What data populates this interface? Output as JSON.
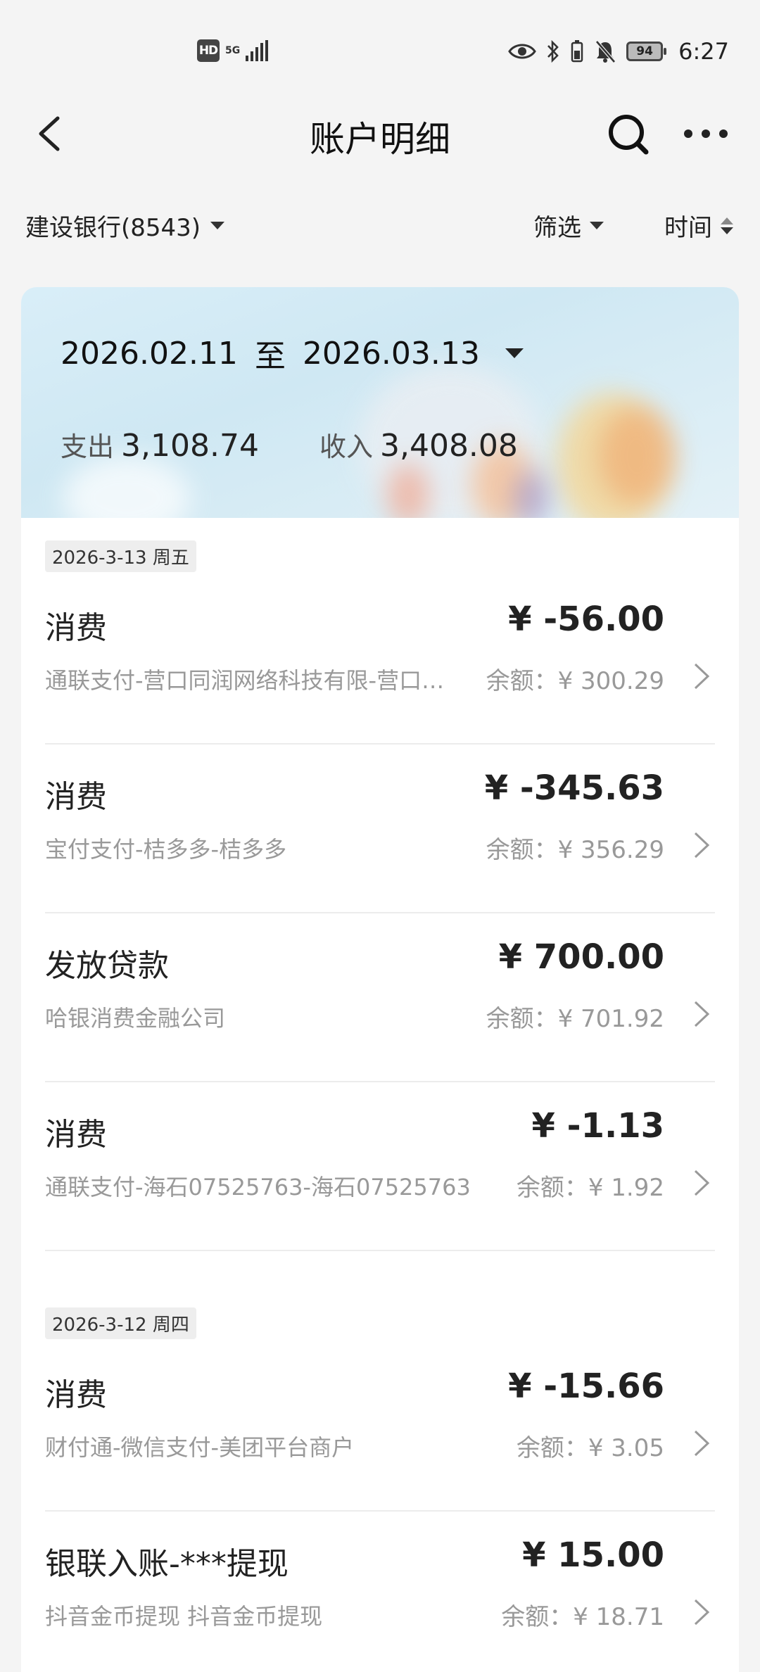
{
  "status_bar": {
    "hd": "HD",
    "network": "5G",
    "battery": "94",
    "time": "6:27"
  },
  "header": {
    "title": "账户明细"
  },
  "filters": {
    "account": "建设银行(8543)",
    "filter_label": "筛选",
    "sort_label": "时间"
  },
  "summary": {
    "start_date": "2026.02.11",
    "range_sep": "至",
    "end_date": "2026.03.13",
    "expense_label": "支出",
    "expense_value": "3,108.74",
    "income_label": "收入",
    "income_value": "3,408.08"
  },
  "days": [
    {
      "date": "2026-3-13 周五",
      "transactions": [
        {
          "title": "消费",
          "amount": "¥ -56.00",
          "desc": "通联支付-营口同润网络科技有限-营口同润网络科技有限公司",
          "balance": "余额：¥ 300.29"
        },
        {
          "title": "消费",
          "amount": "¥ -345.63",
          "desc": "宝付支付-桔多多-桔多多",
          "balance": "余额：¥ 356.29"
        },
        {
          "title": "发放贷款",
          "amount": "¥ 700.00",
          "desc": "哈银消费金融公司",
          "balance": "余额：¥ 701.92"
        },
        {
          "title": "消费",
          "amount": "¥ -1.13",
          "desc": "通联支付-海石07525763-海石07525763",
          "balance": "余额：¥ 1.92"
        }
      ]
    },
    {
      "date": "2026-3-12 周四",
      "transactions": [
        {
          "title": "消费",
          "amount": "¥ -15.66",
          "desc": "财付通-微信支付-美团平台商户",
          "balance": "余额：¥ 3.05"
        },
        {
          "title": "银联入账-***提现",
          "amount": "¥ 15.00",
          "desc": "抖音金币提现 抖音金币提现",
          "balance": "余额：¥ 18.71"
        }
      ]
    }
  ]
}
